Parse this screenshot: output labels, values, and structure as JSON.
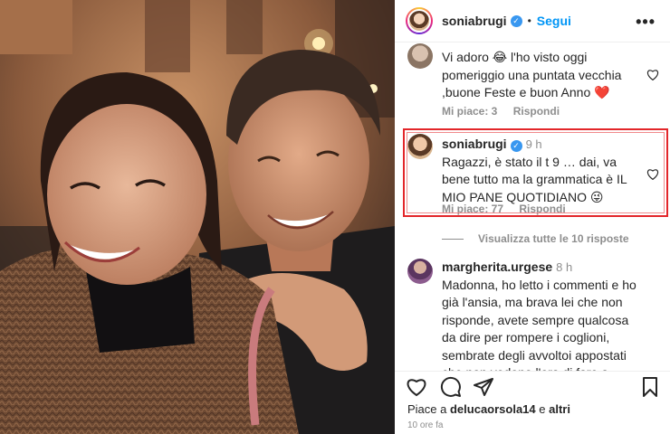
{
  "post": {
    "author": "soniabrugi",
    "separator": "•",
    "follow_label": "Segui",
    "more_label": "•••"
  },
  "comments": [
    {
      "text": "Vi adoro 😂 l'ho visto oggi pomeriggio una puntata vecchia ,buone Feste e buon Anno ❤️",
      "likes_label": "Mi piace: 3",
      "reply_label": "Rispondi"
    },
    {
      "user": "soniabrugi",
      "time": "9 h",
      "text": "Ragazzi, è stato il t 9 … dai, va bene tutto ma la grammatica è IL MIO PANE QUOTIDIANO 😜",
      "likes_label": "Mi piace: 77",
      "reply_label": "Rispondi",
      "highlighted": true
    },
    {
      "user": "margherita.urgese",
      "time": "8 h",
      "text": "Madonna, ho letto i commenti e ho già l'ansia, ma brava lei che non risponde, avete sempre qualcosa da dire per rompere i coglioni, sembrate degli avvoltoi appostati che non vedono l'ora di fare a pezzi la preda. Vi"
    }
  ],
  "view_replies_label": "Visualizza tutte le 10 risposte",
  "footer": {
    "liked_prefix": "Piace a ",
    "liked_user": "delucaorsola14",
    "liked_mid": " e ",
    "liked_others": "altri",
    "timestamp": "10 ore fa"
  },
  "icons": {
    "heart": "heart-icon",
    "comment": "comment-icon",
    "share": "share-icon",
    "save": "bookmark-icon",
    "verified": "verified-icon",
    "more": "more-icon"
  },
  "colors": {
    "accent": "#0095f6",
    "verified": "#3897f0",
    "highlight_border": "#e3262a",
    "heart_like": "#e0245e"
  }
}
